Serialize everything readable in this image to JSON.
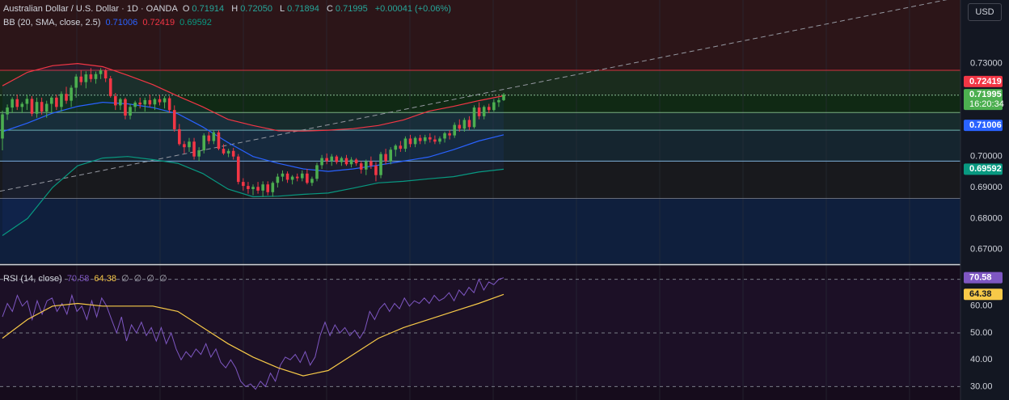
{
  "header": {
    "symbol": "Australian Dollar / U.S. Dollar · 1D · OANDA",
    "ohlc": [
      {
        "key": "O",
        "value": "0.71914"
      },
      {
        "key": "H",
        "value": "0.72050"
      },
      {
        "key": "L",
        "value": "0.71894"
      },
      {
        "key": "C",
        "value": "0.71995"
      }
    ],
    "change": "+0.00041 (+0.06%)",
    "currency": "USD"
  },
  "bb_legend": {
    "label": "BB (20, SMA, close, 2.5)",
    "values": [
      "0.71006",
      "0.72419",
      "0.69592"
    ],
    "colors": [
      "#2962ff",
      "#f23645",
      "#089981"
    ]
  },
  "rsi_legend": {
    "label": "RSI (14, close)",
    "values": [
      "70.58",
      "64.38",
      "∅",
      "∅",
      "∅",
      "∅"
    ],
    "colors": [
      "#7e57c2",
      "#f7c948",
      "#b2b5be",
      "#b2b5be",
      "#b2b5be",
      "#b2b5be"
    ]
  },
  "colors": {
    "up": "#4caf50",
    "down": "#f23645",
    "bb_basis": "#2962ff",
    "bb_upper": "#f23645",
    "bb_lower": "#089981",
    "rsi": "#7e57c2",
    "rsi_ma": "#f7c948",
    "background": "#131722"
  },
  "chart_data": [
    {
      "type": "candlestick",
      "title": "Australian Dollar / U.S. Dollar · 1D · OANDA",
      "ylim": [
        0.6655,
        0.7505
      ],
      "y_ticks": [
        "0.67000",
        "0.68000",
        "0.69000",
        "0.70000",
        "0.71000",
        "0.72000",
        "0.73000"
      ],
      "price_labels": [
        {
          "value": "0.72419",
          "color": "#f23645"
        },
        {
          "value": "0.71995",
          "color": "#4caf50",
          "sub": "16:20:34"
        },
        {
          "value": "0.71006",
          "color": "#2962ff"
        },
        {
          "value": "0.69592",
          "color": "#089981"
        }
      ],
      "horizontal_levels": [
        0.7278,
        0.7198,
        0.7142,
        0.7085,
        0.6985,
        0.6865
      ],
      "trend_line": {
        "from": 0.6888,
        "to": 0.7515
      },
      "candles": [
        [
          0.7058,
          0.7148,
          0.702,
          0.7136
        ],
        [
          0.7136,
          0.7168,
          0.7118,
          0.7158
        ],
        [
          0.7158,
          0.7191,
          0.714,
          0.7185
        ],
        [
          0.7185,
          0.72,
          0.715,
          0.716
        ],
        [
          0.716,
          0.7176,
          0.714,
          0.717
        ],
        [
          0.717,
          0.72,
          0.715,
          0.7186
        ],
        [
          0.7186,
          0.7195,
          0.713,
          0.7138
        ],
        [
          0.7138,
          0.719,
          0.7125,
          0.7176
        ],
        [
          0.7176,
          0.719,
          0.7135,
          0.7145
        ],
        [
          0.7145,
          0.718,
          0.7125,
          0.717
        ],
        [
          0.717,
          0.7195,
          0.714,
          0.719
        ],
        [
          0.719,
          0.72,
          0.715,
          0.716
        ],
        [
          0.716,
          0.721,
          0.7145,
          0.7202
        ],
        [
          0.7202,
          0.7225,
          0.717,
          0.718
        ],
        [
          0.718,
          0.723,
          0.716,
          0.7222
        ],
        [
          0.7222,
          0.7266,
          0.719,
          0.7258
        ],
        [
          0.7258,
          0.7278,
          0.723,
          0.724
        ],
        [
          0.724,
          0.7275,
          0.722,
          0.7265
        ],
        [
          0.7265,
          0.7285,
          0.724,
          0.725
        ],
        [
          0.725,
          0.7274,
          0.7235,
          0.7266
        ],
        [
          0.7266,
          0.7285,
          0.725,
          0.7278
        ],
        [
          0.7278,
          0.7282,
          0.724,
          0.7252
        ],
        [
          0.7252,
          0.726,
          0.719,
          0.7195
        ],
        [
          0.7195,
          0.7205,
          0.715,
          0.7165
        ],
        [
          0.7165,
          0.719,
          0.715,
          0.7185
        ],
        [
          0.7185,
          0.719,
          0.712,
          0.7132
        ],
        [
          0.7132,
          0.717,
          0.712,
          0.716
        ],
        [
          0.716,
          0.718,
          0.7145,
          0.7174
        ],
        [
          0.7174,
          0.719,
          0.7155,
          0.7168
        ],
        [
          0.7168,
          0.719,
          0.7145,
          0.7182
        ],
        [
          0.7182,
          0.72,
          0.716,
          0.7168
        ],
        [
          0.7168,
          0.719,
          0.715,
          0.7185
        ],
        [
          0.7185,
          0.7198,
          0.7165,
          0.7175
        ],
        [
          0.7175,
          0.7195,
          0.7155,
          0.7188
        ],
        [
          0.7188,
          0.7195,
          0.714,
          0.715
        ],
        [
          0.715,
          0.7165,
          0.708,
          0.7088
        ],
        [
          0.7088,
          0.7105,
          0.7035,
          0.704
        ],
        [
          0.704,
          0.705,
          0.701,
          0.703
        ],
        [
          0.703,
          0.706,
          0.7015,
          0.7048
        ],
        [
          0.7048,
          0.706,
          0.699,
          0.7
        ],
        [
          0.7,
          0.703,
          0.6985,
          0.702
        ],
        [
          0.702,
          0.7075,
          0.701,
          0.7068
        ],
        [
          0.7068,
          0.708,
          0.704,
          0.705
        ],
        [
          0.705,
          0.7085,
          0.704,
          0.7078
        ],
        [
          0.7078,
          0.7085,
          0.702,
          0.7025
        ],
        [
          0.7025,
          0.704,
          0.7005,
          0.701
        ],
        [
          0.701,
          0.7025,
          0.6998,
          0.7018
        ],
        [
          0.7018,
          0.7028,
          0.699,
          0.7
        ],
        [
          0.7,
          0.7008,
          0.691,
          0.6918
        ],
        [
          0.6918,
          0.693,
          0.689,
          0.6905
        ],
        [
          0.6905,
          0.6918,
          0.688,
          0.6895
        ],
        [
          0.6895,
          0.691,
          0.6875,
          0.6902
        ],
        [
          0.6902,
          0.6918,
          0.688,
          0.689
        ],
        [
          0.689,
          0.692,
          0.687,
          0.691
        ],
        [
          0.691,
          0.692,
          0.6875,
          0.6885
        ],
        [
          0.6885,
          0.692,
          0.687,
          0.6915
        ],
        [
          0.6915,
          0.6945,
          0.69,
          0.6935
        ],
        [
          0.6935,
          0.6955,
          0.692,
          0.6945
        ],
        [
          0.6945,
          0.6952,
          0.6915,
          0.6925
        ],
        [
          0.6925,
          0.694,
          0.691,
          0.6935
        ],
        [
          0.6935,
          0.6945,
          0.692,
          0.693
        ],
        [
          0.693,
          0.6955,
          0.692,
          0.6945
        ],
        [
          0.6945,
          0.696,
          0.691,
          0.6915
        ],
        [
          0.6915,
          0.6935,
          0.6905,
          0.6928
        ],
        [
          0.6928,
          0.698,
          0.692,
          0.6972
        ],
        [
          0.6972,
          0.7005,
          0.696,
          0.6995
        ],
        [
          0.6995,
          0.701,
          0.6975,
          0.6985
        ],
        [
          0.6985,
          0.7008,
          0.697,
          0.7
        ],
        [
          0.7,
          0.7005,
          0.6975,
          0.6982
        ],
        [
          0.6982,
          0.7,
          0.697,
          0.6995
        ],
        [
          0.6995,
          0.7005,
          0.697,
          0.6975
        ],
        [
          0.6975,
          0.6998,
          0.6965,
          0.699
        ],
        [
          0.699,
          0.6995,
          0.697,
          0.6978
        ],
        [
          0.6978,
          0.6985,
          0.6945,
          0.6958
        ],
        [
          0.6958,
          0.699,
          0.694,
          0.6985
        ],
        [
          0.6985,
          0.7,
          0.696,
          0.697
        ],
        [
          0.697,
          0.6982,
          0.692,
          0.694
        ],
        [
          0.694,
          0.7015,
          0.693,
          0.7008
        ],
        [
          0.7008,
          0.7025,
          0.6975,
          0.6985
        ],
        [
          0.6985,
          0.703,
          0.6975,
          0.7022
        ],
        [
          0.7022,
          0.704,
          0.7,
          0.7035
        ],
        [
          0.7035,
          0.705,
          0.7015,
          0.7025
        ],
        [
          0.7025,
          0.7065,
          0.7015,
          0.7058
        ],
        [
          0.7058,
          0.707,
          0.703,
          0.704
        ],
        [
          0.704,
          0.7065,
          0.703,
          0.706
        ],
        [
          0.706,
          0.707,
          0.704,
          0.705
        ],
        [
          0.705,
          0.707,
          0.704,
          0.7062
        ],
        [
          0.7062,
          0.7075,
          0.7045,
          0.7055
        ],
        [
          0.7055,
          0.7068,
          0.704,
          0.7048
        ],
        [
          0.7048,
          0.7065,
          0.704,
          0.7058
        ],
        [
          0.7058,
          0.708,
          0.7045,
          0.7075
        ],
        [
          0.7075,
          0.7085,
          0.7055,
          0.7068
        ],
        [
          0.7068,
          0.711,
          0.706,
          0.7102
        ],
        [
          0.7102,
          0.712,
          0.708,
          0.709
        ],
        [
          0.709,
          0.7125,
          0.708,
          0.7118
        ],
        [
          0.7118,
          0.713,
          0.7085,
          0.7095
        ],
        [
          0.7095,
          0.7165,
          0.709,
          0.7158
        ],
        [
          0.7158,
          0.7175,
          0.712,
          0.713
        ],
        [
          0.713,
          0.7165,
          0.712,
          0.716
        ],
        [
          0.716,
          0.717,
          0.714,
          0.715
        ],
        [
          0.715,
          0.7185,
          0.7145,
          0.7175
        ],
        [
          0.7175,
          0.719,
          0.716,
          0.7182
        ],
        [
          0.7182,
          0.7205,
          0.7179,
          0.72
        ]
      ],
      "bb_upper": [
        0.7228,
        0.7272,
        0.7293,
        0.73,
        0.729,
        0.7262,
        0.7232,
        0.7195,
        0.716,
        0.712,
        0.71,
        0.7083,
        0.7082,
        0.7085,
        0.709,
        0.71,
        0.7118,
        0.7146,
        0.7162,
        0.718,
        0.7196
      ],
      "bb_basis": [
        0.708,
        0.7108,
        0.714,
        0.7162,
        0.7175,
        0.717,
        0.7158,
        0.7138,
        0.7095,
        0.7045,
        0.7,
        0.6978,
        0.696,
        0.6952,
        0.696,
        0.6972,
        0.6985,
        0.6998,
        0.7022,
        0.705,
        0.707
      ],
      "bb_lower": [
        0.6745,
        0.68,
        0.69,
        0.697,
        0.6995,
        0.7,
        0.699,
        0.6978,
        0.6945,
        0.6895,
        0.687,
        0.6872,
        0.6878,
        0.6882,
        0.6898,
        0.6915,
        0.692,
        0.6928,
        0.6935,
        0.695,
        0.6959
      ]
    },
    {
      "type": "line",
      "title": "RSI (14, close)",
      "ylim": [
        25,
        75
      ],
      "y_ticks": [
        "30.00",
        "40.00",
        "50.00",
        "60.00"
      ],
      "hlines": [
        70,
        50,
        30
      ],
      "current_labels": [
        {
          "value": "70.58",
          "color": "#7e57c2"
        },
        {
          "value": "64.38",
          "color": "#f7c948"
        }
      ],
      "series": [
        {
          "values": [
            56,
            61,
            58,
            64,
            60,
            62,
            55,
            62,
            57,
            62,
            63,
            58,
            61,
            57,
            64,
            58,
            60,
            55,
            62,
            56,
            63,
            60,
            55,
            50,
            56,
            47,
            53,
            50,
            54,
            49,
            52,
            47,
            52,
            46,
            50,
            44,
            40,
            43,
            41,
            44,
            42,
            46,
            41,
            44,
            39,
            37,
            40,
            37,
            32,
            30,
            31,
            29,
            32,
            30,
            35,
            32,
            38,
            41,
            40,
            42,
            39,
            43,
            38,
            41,
            49,
            54,
            49,
            53,
            50,
            52,
            49,
            51,
            48,
            51,
            58,
            55,
            59,
            61,
            58,
            61,
            59,
            63,
            60,
            62,
            61,
            63,
            61,
            64,
            62,
            63,
            65,
            62,
            66,
            64,
            67,
            65,
            70,
            66,
            69,
            68,
            70,
            70.58
          ]
        },
        {
          "values": [
            48,
            55,
            60,
            61,
            60,
            60,
            60,
            58,
            52,
            46,
            41,
            37,
            34,
            36,
            42,
            48,
            52,
            55,
            58,
            61,
            64.38
          ]
        }
      ]
    }
  ]
}
